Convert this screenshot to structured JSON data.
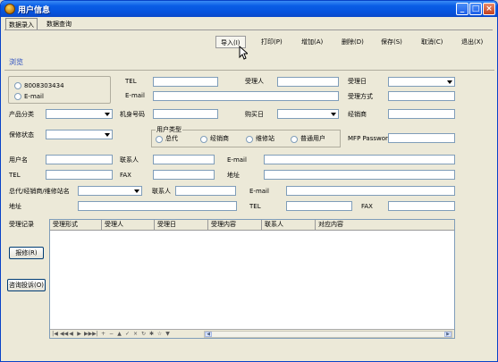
{
  "window": {
    "title": "用户信息"
  },
  "tabs": [
    {
      "label": "数据录入",
      "active": true
    },
    {
      "label": "数据查询",
      "active": false
    }
  ],
  "toolbar": {
    "import": "导入(I)",
    "print": "打印(P)",
    "add": "增加(A)",
    "delete": "删除(D)",
    "save": "保存(S)",
    "cancel": "取消(C)",
    "exit": "退出(X)"
  },
  "section_title": "浏览",
  "phone_options": [
    {
      "label": "8008303434"
    },
    {
      "label": "E-mail"
    }
  ],
  "form": {
    "tel": "TEL",
    "email": "E-mail",
    "handler": "受理人",
    "accept_date": "受理日",
    "accept_method": "受理方式",
    "product_category": "产品分类",
    "machine_no": "机身号码",
    "purchase_date": "购买日",
    "dealer": "经销商",
    "warranty_status": "保修状态",
    "user_type": "用户类型",
    "user_types": [
      "总代",
      "经销商",
      "维修站",
      "普通用户"
    ],
    "mfp_password": "MFP Password",
    "user_name": "用户名",
    "contact": "联系人",
    "email2": "E-mail",
    "tel2": "TEL",
    "fax": "FAX",
    "address": "地址",
    "agent_name": "总代/经销商/维修站名",
    "contact2": "联系人",
    "email3": "E-mail",
    "address2": "地址",
    "contact3": "联系人",
    "tel3": "TEL",
    "fax2": "FAX"
  },
  "records": {
    "label": "受理记录",
    "columns": [
      "受理形式",
      "受理人",
      "受理日",
      "受理内容",
      "联系人",
      "对应内容"
    ]
  },
  "side_buttons": {
    "repair": "报修(R)",
    "complaint": "咨询投诉(O)"
  }
}
